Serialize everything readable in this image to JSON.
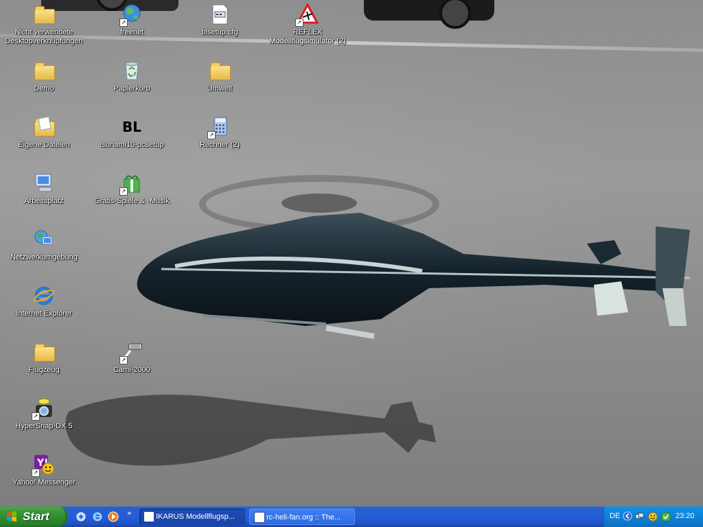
{
  "desktop": {
    "icons": [
      {
        "label": "Nicht verwendete Desktopverknüpfungen",
        "lines": [
          "Nicht verwendete",
          "Desktopverknüpfungen"
        ],
        "icon": "folder-icon"
      },
      {
        "label": "freenet",
        "icon": "globe-icon"
      },
      {
        "label": "blsetup.cfg",
        "icon": "config-file-icon"
      },
      {
        "label": "REFLEX Modellflugsimulator (2)",
        "lines": [
          "REFLEX",
          "Modellflugsimulator (2)"
        ],
        "icon": "reflex-warning-icon"
      },
      {
        "label": "Demo",
        "icon": "folder-icon"
      },
      {
        "label": "Papierkorb",
        "icon": "recycle-bin-icon"
      },
      {
        "label": "Umwelt",
        "icon": "folder-icon"
      },
      {
        "label": "Eigene Dateien",
        "icon": "my-documents-icon"
      },
      {
        "label": "tsunami10-pcsetup",
        "icon": "bl-icon",
        "glyph_text": "BL"
      },
      {
        "label": "Rechner (2)",
        "icon": "calculator-icon"
      },
      {
        "label": "Arbeitsplatz",
        "icon": "my-computer-icon"
      },
      {
        "label": "Gratis-Spiele & -Musik",
        "icon": "gift-icon"
      },
      {
        "label": "Netzwerkumgebung",
        "icon": "network-icon"
      },
      {
        "label": "Internet Explorer",
        "icon": "internet-explorer-icon"
      },
      {
        "label": "Flugzeug",
        "icon": "folder-icon"
      },
      {
        "label": "Cami-2000",
        "icon": "cami-icon"
      },
      {
        "label": "HyperSnap-DX 5",
        "icon": "camera-icon"
      },
      {
        "label": "Yahoo! Messenger",
        "icon": "yahoo-messenger-icon"
      }
    ]
  },
  "taskbar": {
    "start_label": "Start",
    "chevron": "»",
    "tasks": [
      {
        "label": "IKARUS Modellflugsp...",
        "state": "active"
      },
      {
        "label": "rc-heli-fan.org :: The...",
        "state": "inactive"
      }
    ],
    "tray": {
      "language": "DE",
      "clock": "23:20"
    }
  },
  "colors": {
    "taskbar_blue": "#245edb",
    "start_green": "#3c9a3a",
    "tray_blue": "#0f81d8"
  }
}
